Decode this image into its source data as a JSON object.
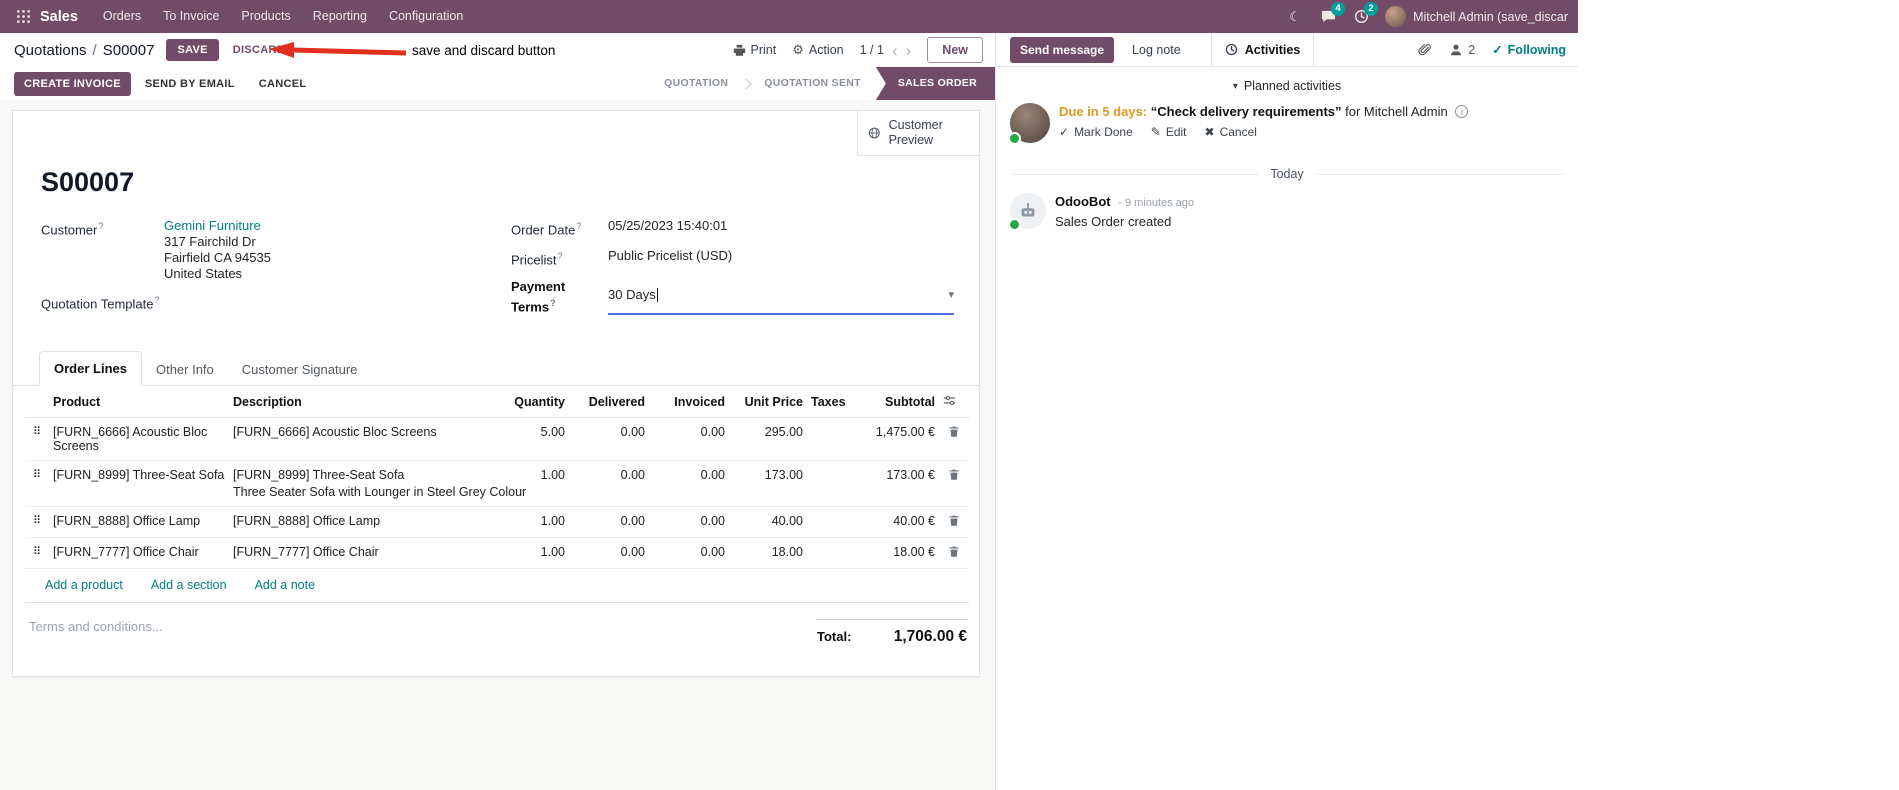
{
  "navbar": {
    "app_name": "Sales",
    "menus": [
      {
        "label": "Orders"
      },
      {
        "label": "To Invoice"
      },
      {
        "label": "Products"
      },
      {
        "label": "Reporting"
      },
      {
        "label": "Configuration"
      }
    ],
    "messages_badge": "4",
    "activities_badge": "2",
    "user_name": "Mitchell Admin (save_discar"
  },
  "control_panel": {
    "breadcrumb_parent": "Quotations",
    "breadcrumb_separator": "/",
    "breadcrumb_current": "S00007",
    "save_button": "SAVE",
    "discard_button": "DISCARD",
    "print_button": "Print",
    "action_button": "Action",
    "pager_value": "1 / 1",
    "new_button": "New"
  },
  "annotation": {
    "text": "save and discard button"
  },
  "statusbar": {
    "create_invoice_button": "CREATE INVOICE",
    "send_by_email_button": "SEND BY EMAIL",
    "cancel_button": "CANCEL",
    "stages": [
      {
        "label": "QUOTATION"
      },
      {
        "label": "QUOTATION SENT"
      },
      {
        "label": "SALES ORDER"
      }
    ]
  },
  "form": {
    "customer_preview_label": "Customer Preview",
    "title": "S00007",
    "help_marker": "?",
    "customer_label": "Customer",
    "customer_name": "Gemini Furniture",
    "customer_address_line1": "317 Fairchild Dr",
    "customer_address_line2": "Fairfield CA 94535",
    "customer_address_line3": "United States",
    "quotation_template_label": "Quotation Template",
    "order_date_label": "Order Date",
    "order_date_value": "05/25/2023 15:40:01",
    "pricelist_label": "Pricelist",
    "pricelist_value": "Public Pricelist (USD)",
    "payment_terms_label": "Payment Terms",
    "payment_terms_value": "30 Days",
    "tabs": [
      {
        "label": "Order Lines"
      },
      {
        "label": "Other Info"
      },
      {
        "label": "Customer Signature"
      }
    ],
    "order_lines": {
      "headers": {
        "product": "Product",
        "description": "Description",
        "quantity": "Quantity",
        "delivered": "Delivered",
        "invoiced": "Invoiced",
        "unit_price": "Unit Price",
        "taxes": "Taxes",
        "subtotal": "Subtotal"
      },
      "rows": [
        {
          "product": "[FURN_6666] Acoustic Bloc Screens",
          "description": "[FURN_6666] Acoustic Bloc Screens",
          "description_extra": "",
          "quantity": "5.00",
          "delivered": "0.00",
          "invoiced": "0.00",
          "unit_price": "295.00",
          "taxes": "",
          "subtotal": "1,475.00 €"
        },
        {
          "product": "[FURN_8999] Three-Seat Sofa",
          "description": "[FURN_8999] Three-Seat Sofa",
          "description_extra": "Three Seater Sofa with Lounger in Steel Grey Colour",
          "quantity": "1.00",
          "delivered": "0.00",
          "invoiced": "0.00",
          "unit_price": "173.00",
          "taxes": "",
          "subtotal": "173.00 €"
        },
        {
          "product": "[FURN_8888] Office Lamp",
          "description": "[FURN_8888] Office Lamp",
          "description_extra": "",
          "quantity": "1.00",
          "delivered": "0.00",
          "invoiced": "0.00",
          "unit_price": "40.00",
          "taxes": "",
          "subtotal": "40.00 €"
        },
        {
          "product": "[FURN_7777] Office Chair",
          "description": "[FURN_7777] Office Chair",
          "description_extra": "",
          "quantity": "1.00",
          "delivered": "0.00",
          "invoiced": "0.00",
          "unit_price": "18.00",
          "taxes": "",
          "subtotal": "18.00 €"
        }
      ],
      "add_product_link": "Add a product",
      "add_section_link": "Add a section",
      "add_note_link": "Add a note"
    },
    "terms_placeholder": "Terms and conditions...",
    "total_label": "Total:",
    "total_value": "1,706.00 €"
  },
  "chatter": {
    "send_message_button": "Send message",
    "log_note_button": "Log note",
    "activities_tab": "Activities",
    "followers_count": "2",
    "following_label": "Following",
    "planned_activities_header": "Planned activities",
    "activity": {
      "due_text": "Due in 5 days:",
      "summary": "“Check delivery requirements”",
      "assignee_text": "for Mitchell Admin",
      "mark_done_button": "Mark Done",
      "edit_button": "Edit",
      "cancel_button": "Cancel"
    },
    "date_separator": "Today",
    "message": {
      "author": "OdooBot",
      "timestamp": "- 9 minutes ago",
      "body": "Sales Order created"
    }
  }
}
